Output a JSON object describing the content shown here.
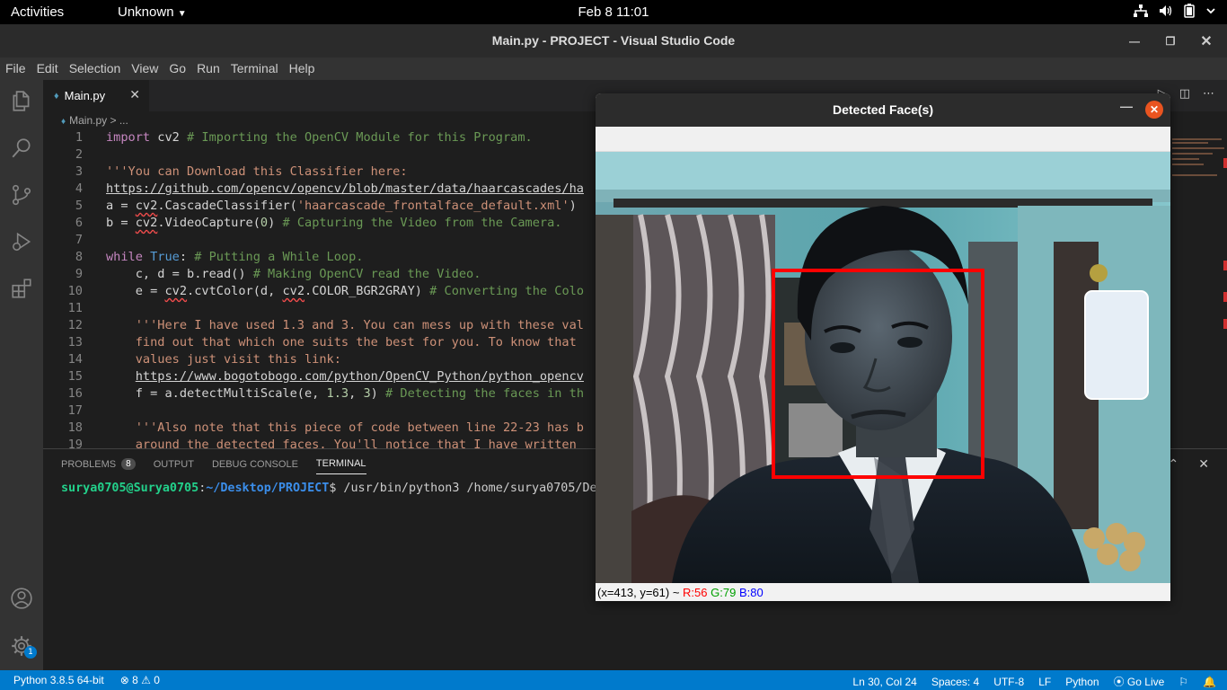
{
  "topbar": {
    "activities": "Activities",
    "app": "Unknown",
    "clock": "Feb 8  11:01"
  },
  "window": {
    "title": "Main.py - PROJECT - Visual Studio Code"
  },
  "menu": [
    "File",
    "Edit",
    "Selection",
    "View",
    "Go",
    "Run",
    "Terminal",
    "Help"
  ],
  "activity_icons": [
    "files-icon",
    "search-icon",
    "source-control-icon",
    "run-debug-icon",
    "extensions-icon",
    "account-icon",
    "gear-icon"
  ],
  "settings_badge": "1",
  "tab": {
    "label": "Main.py"
  },
  "breadcrumb": {
    "file": "Main.py",
    "rest": " > ..."
  },
  "code_lines": [
    {
      "n": "1"
    },
    {
      "n": "2"
    },
    {
      "n": "3"
    },
    {
      "n": "4"
    },
    {
      "n": "5"
    },
    {
      "n": "6"
    },
    {
      "n": "7"
    },
    {
      "n": "8"
    },
    {
      "n": "9"
    },
    {
      "n": "10"
    },
    {
      "n": "11"
    },
    {
      "n": "12"
    },
    {
      "n": "13"
    },
    {
      "n": "14"
    },
    {
      "n": "15"
    },
    {
      "n": "16"
    },
    {
      "n": "17"
    },
    {
      "n": "18"
    },
    {
      "n": "19"
    }
  ],
  "code": {
    "l1_kw": "import",
    "l1_mod": " cv2 ",
    "l1_cm": "# Importing the OpenCV Module for this Program.",
    "l3": "'''You can Download this Classifier here:",
    "l4": "https://github.com/opencv/opencv/blob/master/data/haarcascades/ha",
    "l5_a": "a = ",
    "l5_b": "cv2",
    "l5_c": ".CascadeClassifier(",
    "l5_d": "'haarcascade_frontalface_default.xml'",
    "l5_e": ")",
    "l6_a": "b = ",
    "l6_b": "cv2",
    "l6_c": ".VideoCapture(",
    "l6_d": "0",
    "l6_e": ") ",
    "l6_f": "# Capturing the Video from the Camera.",
    "l8_a": "while",
    "l8_b": " ",
    "l8_c": "True",
    "l8_d": ": ",
    "l8_e": "# Putting a While Loop.",
    "l9_a": "    c, d = b.read() ",
    "l9_b": "# Making OpenCV read the Video.",
    "l10_a": "    e = ",
    "l10_b": "cv2",
    "l10_c": ".cvtColor(d, ",
    "l10_d": "cv2",
    "l10_e": ".COLOR_BGR2GRAY) ",
    "l10_f": "# Converting the Colo",
    "l12": "    '''Here I have used 1.3 and 3. You can mess up with these val",
    "l13": "    find out that which one suits the best for you. To know that",
    "l14": "    values just visit this link:",
    "l15_a": "    ",
    "l15_b": "https://www.bogotobogo.com/python/OpenCV_Python/python_opencv",
    "l16_a": "    f = a.detectMultiScale(e, ",
    "l16_b": "1.3",
    "l16_c": ", ",
    "l16_d": "3",
    "l16_e": ") ",
    "l16_f": "# Detecting the faces in th",
    "l18": "    '''Also note that this piece of code between line 22-23 has b",
    "l19": "    around the detected faces. You'll notice that I have written"
  },
  "panel": {
    "tabs": [
      "PROBLEMS",
      "OUTPUT",
      "DEBUG CONSOLE",
      "TERMINAL"
    ],
    "problems_count": "8",
    "active_tab": "TERMINAL"
  },
  "terminal": {
    "user": "surya0705@Surya0705",
    "sep": ":",
    "path": "~/Desktop/PROJECT",
    "cmd": "$ /usr/bin/python3 /home/surya0705/De"
  },
  "statusbar": {
    "python": "Python 3.8.5 64-bit",
    "problems": "⊗ 8 ⚠ 0",
    "position": "Ln 30, Col 24",
    "spaces": "Spaces: 4",
    "encoding": "UTF-8",
    "eol": "LF",
    "language": "Python",
    "golive": "Go Live"
  },
  "cv": {
    "title": "Detected Face(s)",
    "status_pos": "(x=413, y=61) ~ ",
    "status_r": "R:56",
    "status_g": "G:79",
    "status_b": "B:80",
    "face_box_color": "#ff0000"
  },
  "colors": {
    "accent": "#007acc",
    "ubuntu_close": "#e95420"
  }
}
